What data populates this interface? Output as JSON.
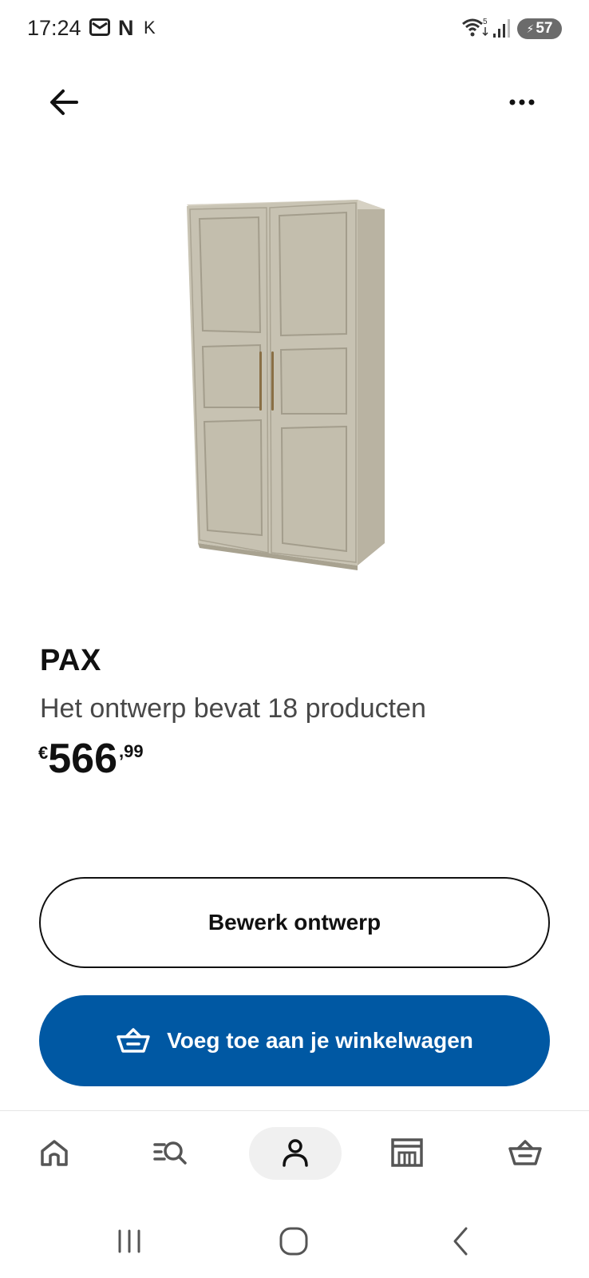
{
  "status_bar": {
    "time": "17:24",
    "notification_letters": [
      "N",
      "K"
    ],
    "wifi_level": "5",
    "battery": "57",
    "icons": [
      "mail-icon",
      "netflix-icon",
      "wifi-icon",
      "signal-icon",
      "battery-icon"
    ]
  },
  "top_nav": {
    "icons": [
      "arrow-left-icon",
      "more-dots-icon"
    ]
  },
  "product": {
    "name": "PAX",
    "description": "Het ontwerp bevat 18 producten",
    "price": {
      "currency": "€",
      "integer": "566",
      "decimal": ",99"
    },
    "image": "wardrobe-image"
  },
  "actions": {
    "edit_label": "Bewerk ontwerp",
    "cart_label": "Voeg toe aan je winkelwagen",
    "cart_icon": "basket-icon"
  },
  "bottom_nav": {
    "items": [
      "home-icon",
      "search-icon",
      "profile-icon",
      "store-icon",
      "basket-icon"
    ],
    "active": "profile"
  },
  "android_nav": {
    "items": [
      "recents-icon",
      "home-circle-icon",
      "back-chevron-icon"
    ]
  },
  "colors": {
    "primary_blue": "#0058a3",
    "text": "#111111",
    "secondary_text": "#484848",
    "wardrobe": "#c7c2b2"
  }
}
